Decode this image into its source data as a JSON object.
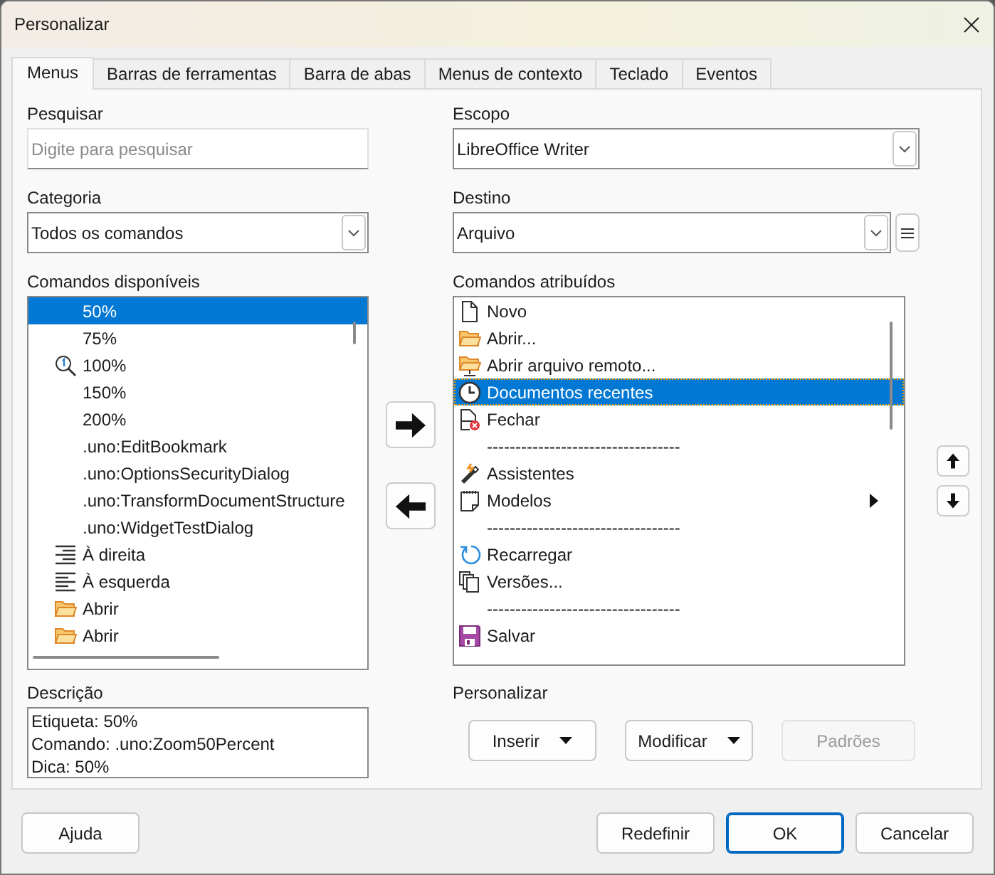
{
  "window": {
    "title": "Personalizar"
  },
  "tabs": [
    {
      "label": "Menus",
      "selected": true
    },
    {
      "label": "Barras de ferramentas",
      "selected": false
    },
    {
      "label": "Barra de abas",
      "selected": false
    },
    {
      "label": "Menus de contexto",
      "selected": false
    },
    {
      "label": "Teclado",
      "selected": false
    },
    {
      "label": "Eventos",
      "selected": false
    }
  ],
  "search": {
    "label": "Pesquisar",
    "placeholder": "Digite para pesquisar"
  },
  "scope": {
    "label": "Escopo",
    "value": "LibreOffice Writer"
  },
  "category": {
    "label": "Categoria",
    "value": "Todos os comandos"
  },
  "target": {
    "label": "Destino",
    "value": "Arquivo"
  },
  "available": {
    "label": "Comandos disponíveis",
    "items": [
      {
        "text": "50%",
        "kind": "plain",
        "selected": true
      },
      {
        "text": "75%",
        "kind": "plain",
        "selected": false
      },
      {
        "text": "100%",
        "kind": "zoom",
        "selected": false
      },
      {
        "text": "150%",
        "kind": "plain",
        "selected": false
      },
      {
        "text": "200%",
        "kind": "plain",
        "selected": false
      },
      {
        "text": ".uno:EditBookmark",
        "kind": "plain",
        "selected": false
      },
      {
        "text": ".uno:OptionsSecurityDialog",
        "kind": "plain",
        "selected": false
      },
      {
        "text": ".uno:TransformDocumentStructure",
        "kind": "plain",
        "selected": false
      },
      {
        "text": ".uno:WidgetTestDialog",
        "kind": "plain",
        "selected": false
      },
      {
        "text": "À direita",
        "kind": "align-right",
        "selected": false
      },
      {
        "text": "À esquerda",
        "kind": "align-left",
        "selected": false
      },
      {
        "text": "Abrir",
        "kind": "folder",
        "selected": false
      },
      {
        "text": "Abrir",
        "kind": "folder",
        "selected": false
      }
    ]
  },
  "assigned": {
    "label": "Comandos atribuídos",
    "items": [
      {
        "kind": "document",
        "text": "Novo",
        "selected": false,
        "submenu": false
      },
      {
        "kind": "folder",
        "text": "Abrir...",
        "selected": false,
        "submenu": false
      },
      {
        "kind": "folder-remote",
        "text": "Abrir arquivo remoto...",
        "selected": false,
        "submenu": false
      },
      {
        "kind": "clock",
        "text": "Documentos recentes",
        "selected": true,
        "submenu": false
      },
      {
        "kind": "close-document",
        "text": "Fechar",
        "selected": false,
        "submenu": false
      },
      {
        "kind": "separator",
        "text": "----------------------------------"
      },
      {
        "kind": "wand",
        "text": "Assistentes",
        "selected": false,
        "submenu": false
      },
      {
        "kind": "notepad",
        "text": "Modelos",
        "selected": false,
        "submenu": true
      },
      {
        "kind": "separator",
        "text": "----------------------------------"
      },
      {
        "kind": "reload",
        "text": "Recarregar",
        "selected": false,
        "submenu": false
      },
      {
        "kind": "copies",
        "text": "Versões...",
        "selected": false,
        "submenu": false
      },
      {
        "kind": "separator",
        "text": "----------------------------------"
      },
      {
        "kind": "save",
        "text": "Salvar",
        "selected": false,
        "submenu": false
      }
    ]
  },
  "description": {
    "label": "Descrição",
    "lines": [
      "Etiqueta: 50%",
      "Comando: .uno:Zoom50Percent",
      "Dica: 50%"
    ]
  },
  "customize": {
    "label": "Personalizar",
    "buttons": [
      {
        "label": "Inserir",
        "menu": true,
        "disabled": false
      },
      {
        "label": "Modificar",
        "menu": true,
        "disabled": false
      },
      {
        "label": "Padrões",
        "menu": false,
        "disabled": true
      }
    ]
  },
  "footer": {
    "left": [
      {
        "label": "Ajuda",
        "default": false
      }
    ],
    "right": [
      {
        "label": "Redefinir",
        "default": false
      },
      {
        "label": "OK",
        "default": true
      },
      {
        "label": "Cancelar",
        "default": false
      }
    ]
  }
}
